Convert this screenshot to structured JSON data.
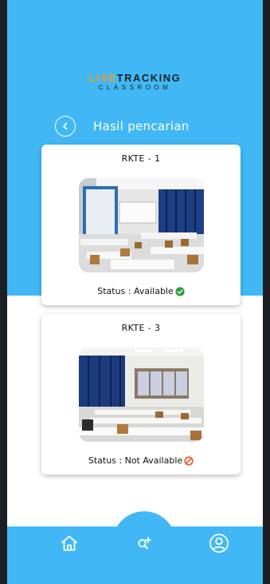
{
  "logo": {
    "line1_accent": "LIVE",
    "line1_rest": "TRACKING",
    "line2": "CLASSROOM"
  },
  "header": {
    "title": "Hasil pencarian"
  },
  "results": [
    {
      "room": "RKTE - 1",
      "status": "Status : Available",
      "status_icon": "check-circle-icon"
    },
    {
      "room": "RKTE - 3",
      "status": "Status : Not Available",
      "status_icon": "prohibited-icon"
    }
  ],
  "nav": {
    "items": [
      "home-icon",
      "search-add-icon",
      "profile-icon"
    ]
  },
  "colors": {
    "primary": "#41b8f5",
    "available": "#2e9e3e",
    "unavailable": "#f0521c",
    "logo_accent": "#f39a1e"
  }
}
